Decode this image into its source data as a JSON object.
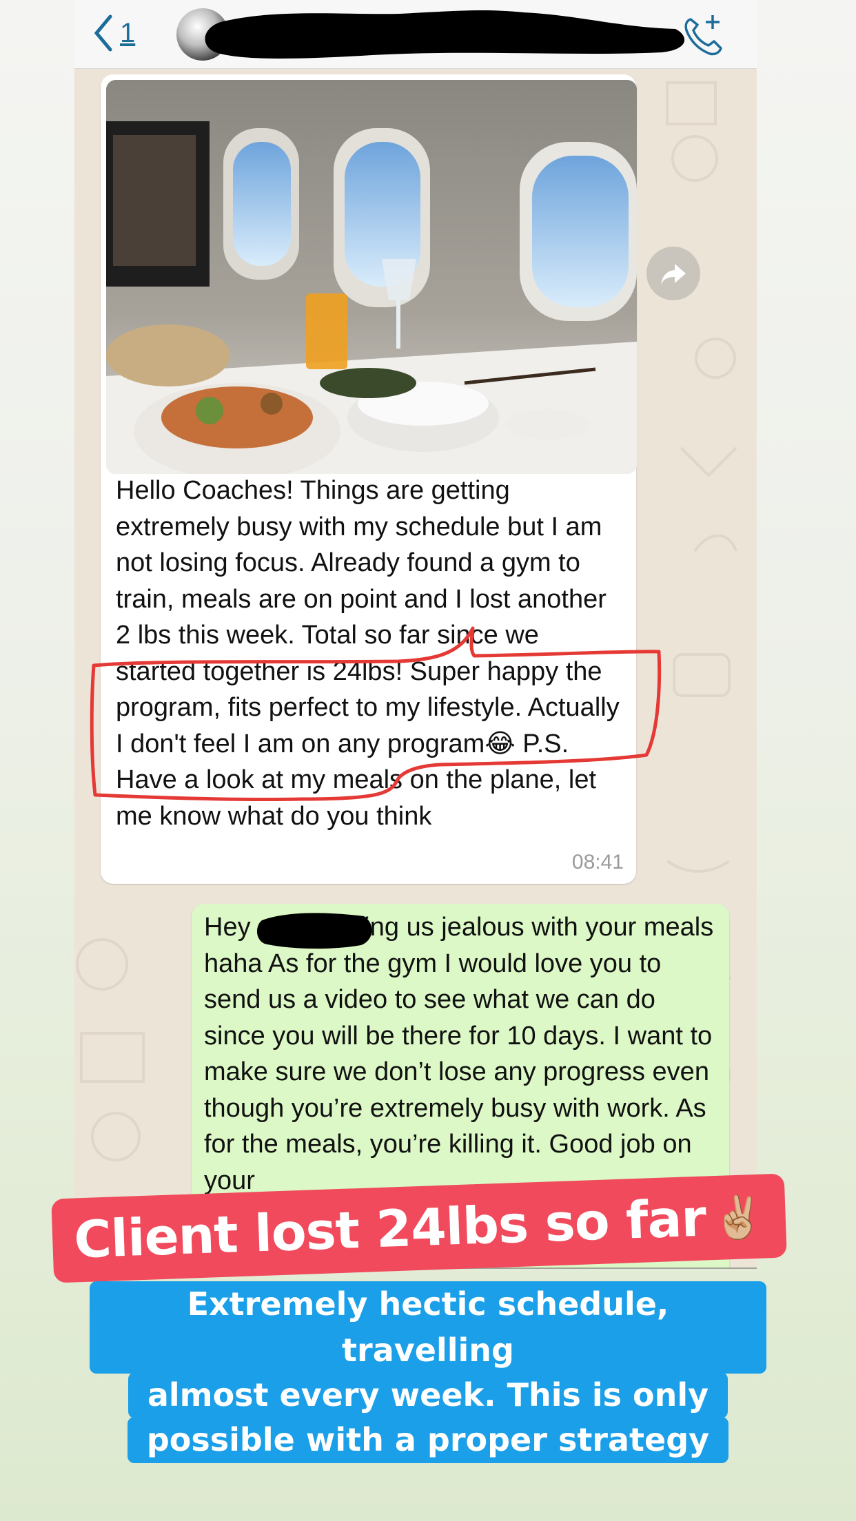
{
  "header": {
    "unread_count": "1"
  },
  "incoming": {
    "text_before": "Hello Coaches! Things are getting extremely busy with my schedule but I am not losing focus. Already found a gym to train, meals are on point and I lost another 2 lbs this week. Total so far since we started together is 24lbs! Super happy the program, fits perfect to my lifestyle. Actually I don't feel I am on any program",
    "emoji": "😂",
    "text_after": "P.S. Have a look at my meals on the plane, let me know what do you think",
    "time": "08:41"
  },
  "outgoing": {
    "text": "Hey stop making us jealous with your meals haha As for the gym I would love you to send us a video to see what we can do since you will be there for 10 days. I want to make sure we don’t lose any progress even though you’re extremely busy with work. As for the meals, you’re killing it. Good job on your"
  },
  "overlay": {
    "banner": "Client lost 24lbs so far",
    "banner_emoji": "✌🏼",
    "caption_lines": [
      "Extremely hectic schedule, travelling",
      "almost every week. This is only",
      "possible with a proper strategy"
    ]
  },
  "colors": {
    "banner_bg": "#f04a5c",
    "caption_bg": "#1a9fe8",
    "outgoing_bubble": "#dcf8c6",
    "ios_blue": "#1c6c9a",
    "highlight_outline": "#e53935"
  }
}
